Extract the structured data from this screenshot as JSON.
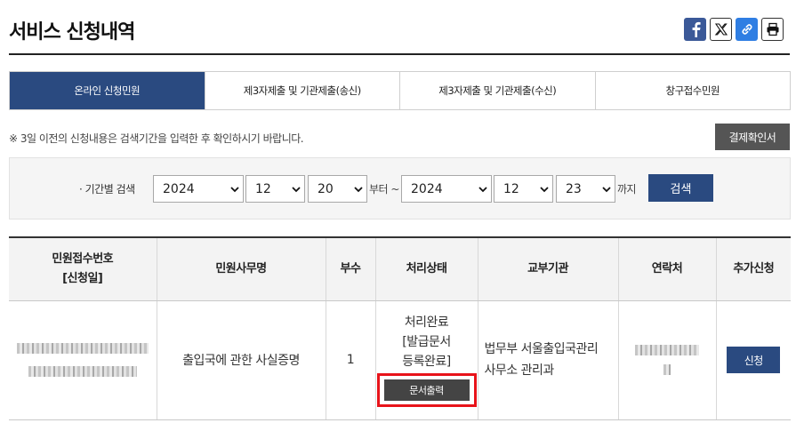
{
  "page": {
    "title": "서비스 신청내역"
  },
  "share": {
    "facebook_icon": "facebook-icon",
    "x_icon": "x-icon",
    "link_icon": "link-icon",
    "print_icon": "print-icon"
  },
  "tabs": [
    {
      "label": "온라인 신청민원",
      "active": true
    },
    {
      "label": "제3자제출 및 기관제출(송신)",
      "active": false
    },
    {
      "label": "제3자제출 및 기관제출(수신)",
      "active": false
    },
    {
      "label": "창구접수민원",
      "active": false
    }
  ],
  "notice": "※ 3일 이전의 신청내용은 검색기간을 입력한 후 확인하시기 바랍니다.",
  "receipt_button": "결제확인서",
  "search": {
    "label": "· 기간별 검색",
    "from": {
      "year": "2024",
      "month": "12",
      "day": "20"
    },
    "from_suffix": "부터 ~",
    "to": {
      "year": "2024",
      "month": "12",
      "day": "23"
    },
    "to_suffix": "까지",
    "button": "검색"
  },
  "table": {
    "headers": {
      "receipt_no_line1": "민원접수번호",
      "receipt_no_line2": "[신청일]",
      "service_name": "민원사무명",
      "copies": "부수",
      "status": "처리상태",
      "issuing_agency": "교부기관",
      "contact": "연락처",
      "additional": "추가신청"
    },
    "row": {
      "service_name": "출입국에 관한 사실증명",
      "copies": "1",
      "status_line1": "처리완료",
      "status_line2": "[발급문서",
      "status_line3": "등록완료]",
      "print_button": "문서출력",
      "agency_line1": "법무부 서울출입국관리",
      "agency_line2": "사무소 관리과",
      "apply_button": "신청"
    }
  },
  "colors": {
    "primary": "#2a4a80",
    "highlight": "#e8131a"
  }
}
